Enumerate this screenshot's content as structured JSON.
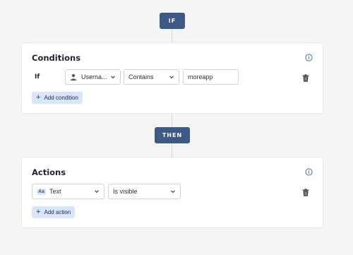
{
  "if_badge": "IF",
  "then_badge": "THEN",
  "conditions": {
    "title": "Conditions",
    "row_label": "If",
    "field_select": "Userna...",
    "operator_select": "Contains",
    "value_input": "moreapp",
    "add_label": "Add condition"
  },
  "actions": {
    "title": "Actions",
    "field_select": "Text",
    "field_badge": "Aa",
    "operator_select": "Is visible",
    "add_label": "Add action"
  },
  "colors": {
    "badge_bg": "#3d5a87",
    "button_bg": "#d9e5fb",
    "info_icon": "#3d6fd4"
  },
  "icons": [
    "info-icon",
    "user-icon",
    "chevron-down-icon",
    "trash-icon",
    "plus-icon",
    "text-type-icon"
  ]
}
